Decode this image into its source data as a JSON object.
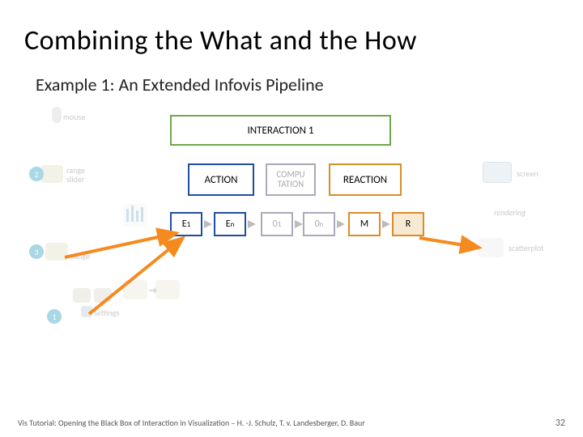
{
  "title": "Combining the What and the How",
  "subtitle": "Example 1: An Extended Infovis Pipeline",
  "overlay": {
    "interaction": "INTERACTION 1",
    "action": "ACTION",
    "compu": "COMPU\nTATION",
    "reaction": "REACTION",
    "cells": {
      "e1_a": "E",
      "e1_b": "1",
      "en_a": "E",
      "en_b": "n",
      "o1_a": "0",
      "o1_b": "1",
      "on_a": "0",
      "on_b": "n",
      "m": "M",
      "r": "R"
    }
  },
  "bg_labels": {
    "mouse": "mouse",
    "range_slider": "range\nslider",
    "range": "range",
    "settings": "settings",
    "screen": "screen",
    "rendering": "rendering",
    "scatterplot": "scatterplot",
    "n1": "1",
    "n2": "2",
    "n3": "3"
  },
  "footer": {
    "credit": "Vis Tutorial: Opening the Black Box of Interaction in Visualization – H. -J. Schulz, T. v. Landesberger, D. Baur",
    "page": "32"
  }
}
